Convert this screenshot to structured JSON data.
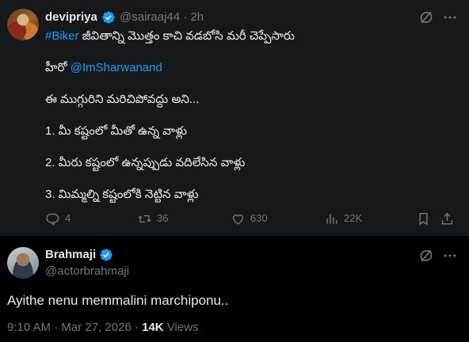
{
  "quoted_post": {
    "author_name": "devipriya",
    "author_handle": "@sairaaj44",
    "separator": "·",
    "timestamp": "2h",
    "hashtag": "#Biker",
    "line1_text": " జీవితాన్ని మొత్తం కాచి వడబోసి మరీ చెప్పేసారు",
    "line2_prefix": "హీరో ",
    "line2_mention": "@ImSharwanand",
    "line3": "ఈ ముగ్గురిని మరిచిపోవద్దు అని...",
    "line4": "1. మీ కష్టంలో మీతో ఉన్న వాళ్లు",
    "line5": "2. మీరు కష్టంలో ఉన్నప్పుడు వదిలేసిన వాళ్లు",
    "line6": "3. మిమ్మల్ని కష్టంలోకి నెట్టిన వాళ్లు",
    "actions": {
      "replies": "4",
      "reposts": "36",
      "likes": "630",
      "views": "22K"
    }
  },
  "main_post": {
    "author_name": "Brahmaji",
    "author_handle": "@actorbrahmaji",
    "text": "Ayithe nenu memmalini marchiponu..",
    "time": "9:10 AM",
    "separator": "·",
    "date": "Mar 27, 2026",
    "separator2": "·",
    "views_count": "14K",
    "views_label": " Views"
  },
  "colors": {
    "background": "#000000",
    "quoted_background": "#16181c",
    "text_primary": "#e7e9ea",
    "text_secondary": "#71767b",
    "accent": "#1d9bf0"
  },
  "icons": [
    "verified-badge-icon",
    "grok-icon",
    "more-icon",
    "reply-icon",
    "repost-icon",
    "like-icon",
    "views-icon",
    "bookmark-icon",
    "share-icon"
  ]
}
